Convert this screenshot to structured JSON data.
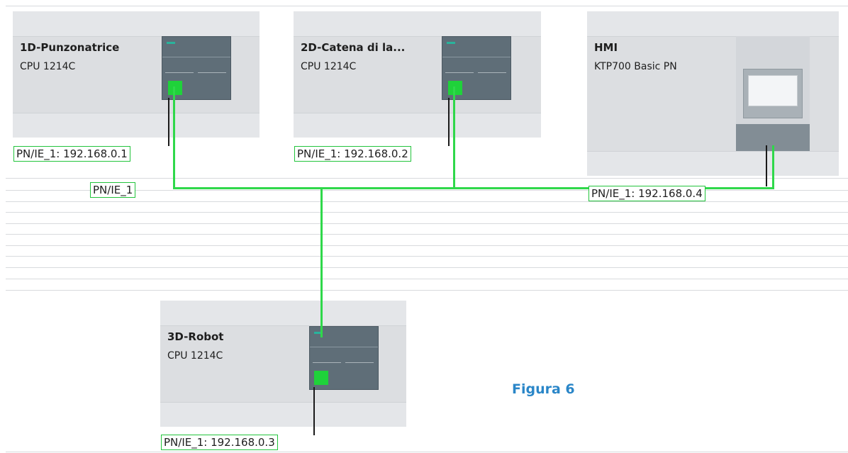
{
  "devices": [
    {
      "name": "1D-Punzonatrice",
      "type": "CPU 1214C",
      "interface_label": "PN/IE_1: 192.168.0.1"
    },
    {
      "name": "2D-Catena di la...",
      "type": "CPU 1214C",
      "interface_label": "PN/IE_1: 192.168.0.2"
    },
    {
      "name": "HMI",
      "type": "KTP700 Basic PN",
      "interface_label": "PN/IE_1: 192.168.0.4"
    },
    {
      "name": "3D-Robot",
      "type": "CPU 1214C",
      "interface_label": "PN/IE_1: 192.168.0.3"
    }
  ],
  "network": {
    "subnet_label": "PN/IE_1"
  },
  "caption": "Figura 6",
  "colors": {
    "network_green": "#2fd84a",
    "caption_blue": "#2a86c8",
    "device_gray": "#dcdee1",
    "plc_body": "#5f6e78"
  }
}
